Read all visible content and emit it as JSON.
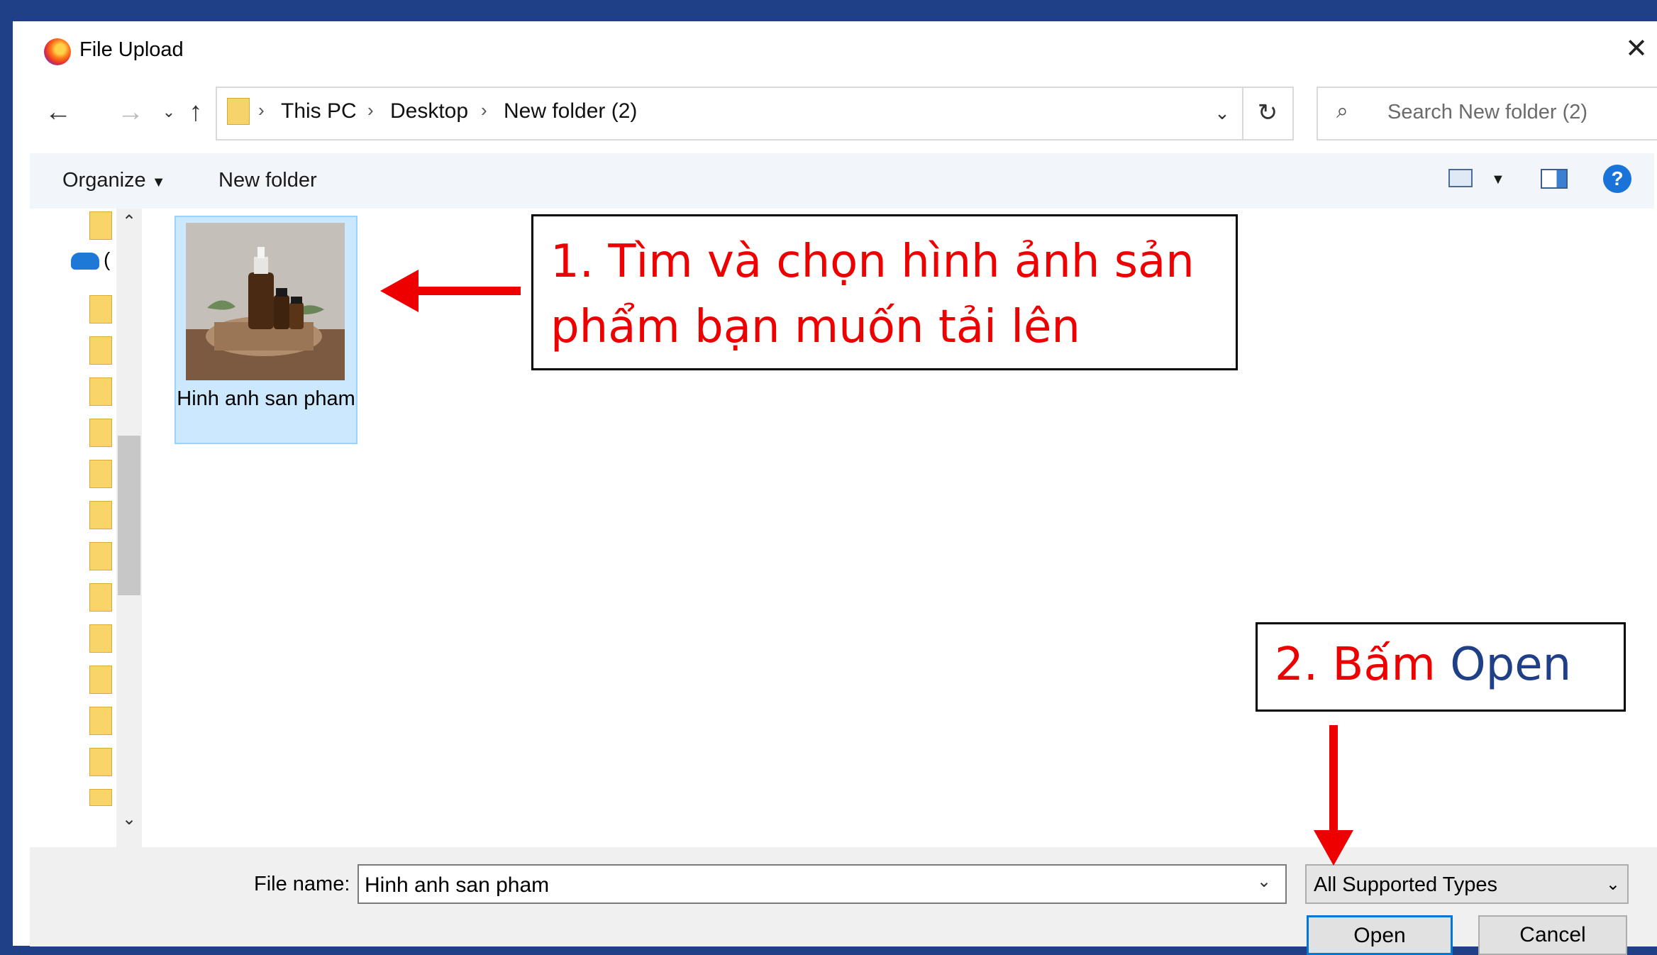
{
  "dialog": {
    "title": "File Upload",
    "close_symbol": "✕"
  },
  "nav": {
    "back_icon": "arrow-left-icon",
    "forward_icon": "arrow-right-icon",
    "recent_icon": "chevron-down-icon",
    "up_icon": "arrow-up-icon",
    "breadcrumbs": [
      "This PC",
      "Desktop",
      "New folder (2)"
    ],
    "refresh_icon": "refresh-icon",
    "search_placeholder": "Search New folder (2)"
  },
  "toolbar": {
    "organize_label": "Organize",
    "new_folder_label": "New folder",
    "help_symbol": "?"
  },
  "navpane": {
    "onedrive_label": "("
  },
  "files": [
    {
      "name": "Hinh anh san pham"
    }
  ],
  "bottom": {
    "file_name_label": "File name:",
    "file_name_value": "Hinh anh san pham",
    "file_type_value": "All Supported Types",
    "open_label": "Open",
    "cancel_label": "Cancel"
  },
  "annotations": {
    "step1": "1. Tìm và chọn hình ảnh sản phẩm bạn muốn tải lên",
    "step2_prefix": "2. Bấm ",
    "step2_word": "Open",
    "color_red": "#ee0000",
    "color_blue": "#1f3f87"
  }
}
